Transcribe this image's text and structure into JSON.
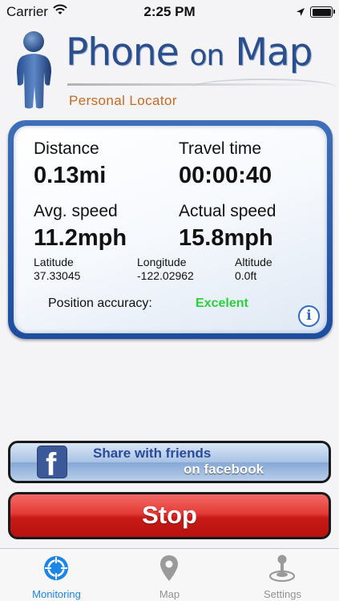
{
  "status_bar": {
    "carrier": "Carrier",
    "time": "2:25 PM"
  },
  "header": {
    "brand_title_part1": "Phone ",
    "brand_title_part2": "on",
    "brand_title_part3": " Map",
    "brand_subtitle": "Personal Locator"
  },
  "stats": {
    "distance_label": "Distance",
    "distance_value": "0.13mi",
    "travel_time_label": "Travel time",
    "travel_time_value": "00:00:40",
    "avg_speed_label": "Avg. speed",
    "avg_speed_value": "11.2mph",
    "actual_speed_label": "Actual speed",
    "actual_speed_value": "15.8mph",
    "latitude_label": "Latitude",
    "latitude_value": "37.33045",
    "longitude_label": "Longitude",
    "longitude_value": "-122.02962",
    "altitude_label": "Altitude",
    "altitude_value": "0.0ft",
    "accuracy_label": "Position accuracy:",
    "accuracy_value": "Excelent",
    "info_glyph": "i"
  },
  "facebook_button": {
    "line1": "Share with friends",
    "line2": "on facebook",
    "logo_letter": "f"
  },
  "stop_button": {
    "label": "Stop"
  },
  "tab_bar": {
    "tabs": [
      {
        "label": "Monitoring",
        "icon": "crosshair-icon",
        "active": true
      },
      {
        "label": "Map",
        "icon": "map-pin-icon",
        "active": false
      },
      {
        "label": "Settings",
        "icon": "settings-joystick-icon",
        "active": false
      }
    ]
  },
  "colors": {
    "brand_blue": "#2b4e8c",
    "subtitle_orange": "#c8691e",
    "accuracy_green": "#2ad13a",
    "active_tab": "#1b86e6",
    "stop_red": "#e43a36",
    "panel_border": "#1c4da0"
  }
}
